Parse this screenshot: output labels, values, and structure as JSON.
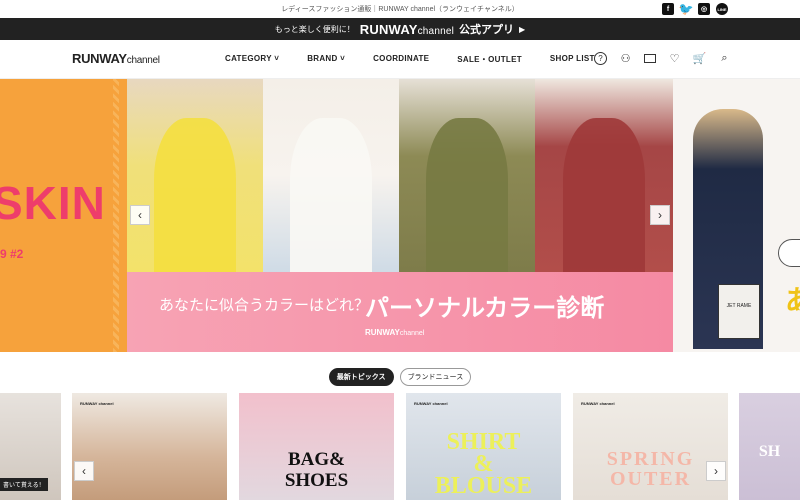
{
  "top": {
    "tagline": "レディースファッション通販｜RUNWAY channel（ランウェイチャンネル）",
    "social": [
      {
        "name": "facebook-icon",
        "glyph": "f"
      },
      {
        "name": "twitter-icon",
        "glyph": "🐦"
      },
      {
        "name": "instagram-icon",
        "glyph": "◎"
      },
      {
        "name": "line-icon",
        "glyph": "LINE"
      }
    ]
  },
  "app_bar": {
    "pre": "もっと楽しく便利に！",
    "brand": "RUNWAY",
    "brand_sub": "channel",
    "app": "公式アプリ",
    "arrow": "▶"
  },
  "nav": {
    "logo": "RUNWAY",
    "logo_sub": "channel",
    "menu": [
      "CATEGORY ˅",
      "BRAND ˅",
      "COORDINATE",
      "SALE・OUTLET",
      "SHOP LIST"
    ],
    "icons": [
      {
        "name": "help-icon",
        "glyph": "?"
      },
      {
        "name": "user-icon",
        "glyph": "⚇"
      },
      {
        "name": "mail-icon",
        "glyph": ""
      },
      {
        "name": "heart-icon",
        "glyph": "♡"
      },
      {
        "name": "cart-icon",
        "glyph": "🛒"
      },
      {
        "name": "search-icon",
        "glyph": "⌕"
      }
    ]
  },
  "hero": {
    "left_text": "SKIN",
    "left_sub": "9 #2",
    "banner_question": "あなたに似合うカラーはどれ？",
    "banner_title": "パーソナルカラー診断",
    "banner_brand": "RUNWAY",
    "banner_brand_sub": "channel",
    "right_bag": "JET RAME",
    "right_yellow": "あ",
    "prev": "‹",
    "next": "›"
  },
  "tabs": [
    "最新トピックス",
    "ブランドニュース"
  ],
  "cards": {
    "c0_label": "書いて貰える！",
    "c1_brand": "RUNWAY channel",
    "c2_title": "BAG&\nSHOES",
    "c3_brand": "RUNWAY channel",
    "c3_title": "SHIRT\n&\nBLOUSE",
    "c4_brand": "RUNWAY channel",
    "c4_title": "SPRING\nOUTER",
    "c5_title": "SH",
    "prev": "‹",
    "next": "›"
  }
}
